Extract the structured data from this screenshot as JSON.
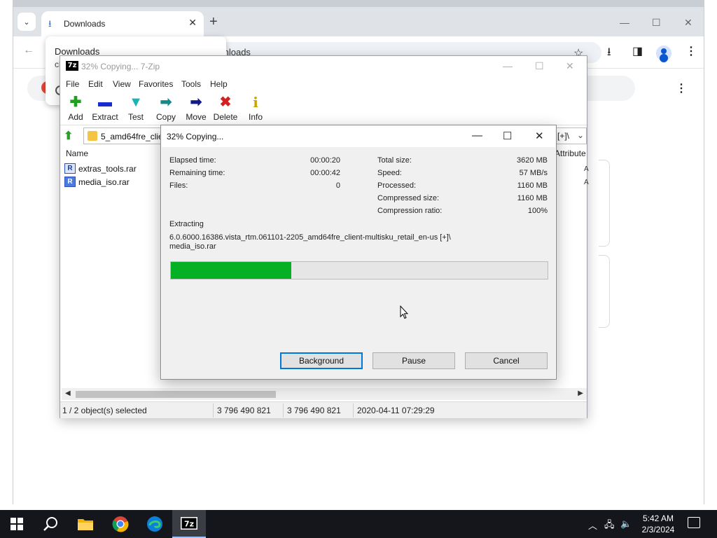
{
  "chrome": {
    "tab_title": "Downloads",
    "omnibox_text": "ownloads",
    "popup_title": "Downloads",
    "popup_sub": "chron"
  },
  "zip": {
    "title": "32% Copying... 7-Zip",
    "menu": [
      "File",
      "Edit",
      "View",
      "Favorites",
      "Tools",
      "Help"
    ],
    "tools": [
      {
        "label": "Add",
        "icon": "add-icon",
        "glyph": "✚",
        "color": "#1ea01e"
      },
      {
        "label": "Extract",
        "icon": "extract-icon",
        "glyph": "▬",
        "color": "#1a2ccf"
      },
      {
        "label": "Test",
        "icon": "test-icon",
        "glyph": "✔",
        "color": "#19b5b5"
      },
      {
        "label": "Copy",
        "icon": "copy-icon",
        "glyph": "➡",
        "color": "#158a8a"
      },
      {
        "label": "Move",
        "icon": "move-icon",
        "glyph": "➡",
        "color": "#14198a"
      },
      {
        "label": "Delete",
        "icon": "delete-icon",
        "glyph": "✖",
        "color": "#d42020"
      },
      {
        "label": "Info",
        "icon": "info-icon",
        "glyph": "i",
        "color": "#c9a400"
      }
    ],
    "address_text": "5_amd64fre_clien",
    "address_end": "[+]\\",
    "column_name": "Name",
    "column_attributes": "Attribute",
    "files": [
      {
        "name": "extras_tools.rar",
        "attr": "A"
      },
      {
        "name": "media_iso.rar",
        "attr": "A"
      }
    ],
    "status": {
      "selected": "1 / 2 object(s) selected",
      "size": "3 796 490 821",
      "packed": "3 796 490 821",
      "modified": "2020-04-11 07:29:29"
    }
  },
  "dialog": {
    "title": "32% Copying...",
    "elapsed_label": "Elapsed time:",
    "elapsed_value": "00:00:20",
    "remaining_label": "Remaining time:",
    "remaining_value": "00:00:42",
    "files_label": "Files:",
    "files_value": "0",
    "total_label": "Total size:",
    "total_value": "3620 MB",
    "speed_label": "Speed:",
    "speed_value": "57 MB/s",
    "processed_label": "Processed:",
    "processed_value": "1160 MB",
    "compressed_label": "Compressed size:",
    "compressed_value": "1160 MB",
    "ratio_label": "Compression ratio:",
    "ratio_value": "100%",
    "operation": "Extracting",
    "path_line1": "6.0.6000.16386.vista_rtm.061101-2205_amd64fre_client-multisku_retail_en-us [+]\\",
    "path_line2": "media_iso.rar",
    "progress_fraction": 0.32,
    "buttons": {
      "background": "Background",
      "pause": "Pause",
      "cancel": "Cancel"
    }
  },
  "taskbar": {
    "time": "5:42 AM",
    "date": "2/3/2024",
    "apps": [
      "start-icon",
      "search-icon",
      "file-explorer-icon",
      "chrome-icon",
      "edge-icon",
      "7zip-icon"
    ]
  },
  "colors": {
    "progress": "#06b025",
    "default_button_border": "#0078d7",
    "taskbar": "#14161c"
  }
}
